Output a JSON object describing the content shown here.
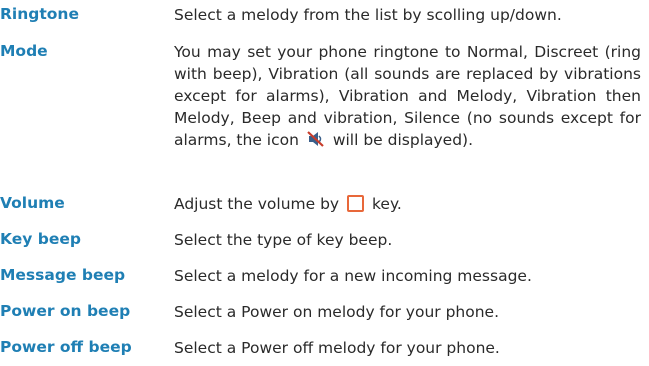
{
  "settings": [
    {
      "term": "Ringtone",
      "desc": "Select a melody from the list by scolling up/down."
    },
    {
      "term": "Mode",
      "desc_before_icon": "You may set your phone ringtone to Normal, Discreet (ring with beep), Vibration (all sounds are replaced by vibrations except for alarms), Vibration and Melody, Vibration then Melody, Beep and vibration, Silence (no sounds except for alarms, the icon",
      "desc_after_icon": "will be displayed).",
      "icon": "silent-mode-icon"
    },
    {
      "term": "Volume",
      "desc_before_icon": "Adjust the volume by",
      "desc_after_icon": "key.",
      "icon": "volume-key-icon"
    },
    {
      "term": "Key beep",
      "desc": "Select the type of key beep."
    },
    {
      "term": "Message beep",
      "desc": "Select a melody for a new incoming message."
    },
    {
      "term": "Power on beep",
      "desc": "Select a Power on melody for your phone."
    },
    {
      "term": "Power off beep",
      "desc": "Select a Power off melody for your phone."
    }
  ],
  "colors": {
    "term": "#1f7fb4",
    "text": "#2a2a2a",
    "key_icon": "#e8683a"
  }
}
